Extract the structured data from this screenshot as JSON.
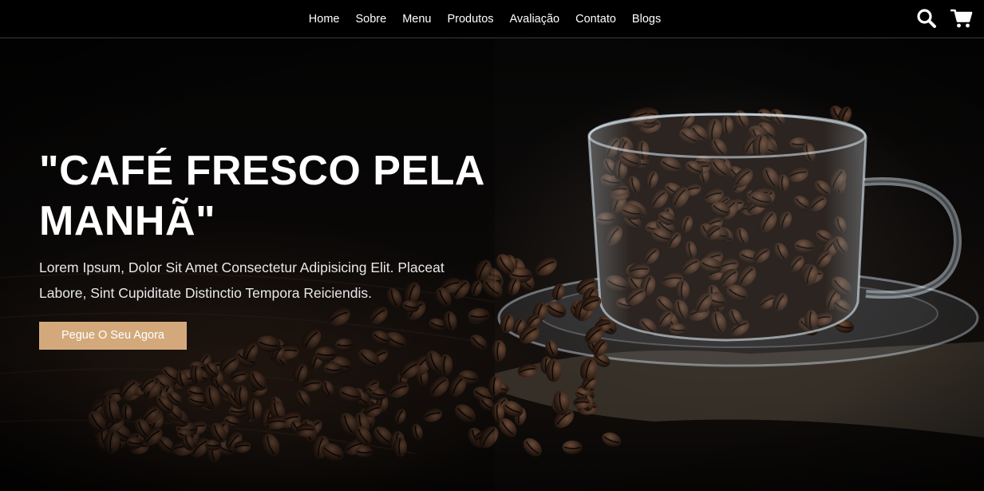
{
  "nav": {
    "items": [
      {
        "label": "Home"
      },
      {
        "label": "Sobre"
      },
      {
        "label": "Menu"
      },
      {
        "label": "Produtos"
      },
      {
        "label": "Avaliação"
      },
      {
        "label": "Contato"
      },
      {
        "label": "Blogs"
      }
    ]
  },
  "header_icons": {
    "search": "search-icon",
    "cart": "cart-icon"
  },
  "hero": {
    "title": "\"CAFÉ FRESCO PELA MANHÃ\"",
    "description": "Lorem Ipsum, Dolor Sit Amet Consectetur Adipisicing Elit. Placeat Labore, Sint Cupiditate Distinctio Tempora Reiciendis.",
    "cta_label": "Pegue O Seu Agora"
  },
  "colors": {
    "accent": "#d3a97c",
    "header_bg": "#000000",
    "text": "#ffffff"
  }
}
